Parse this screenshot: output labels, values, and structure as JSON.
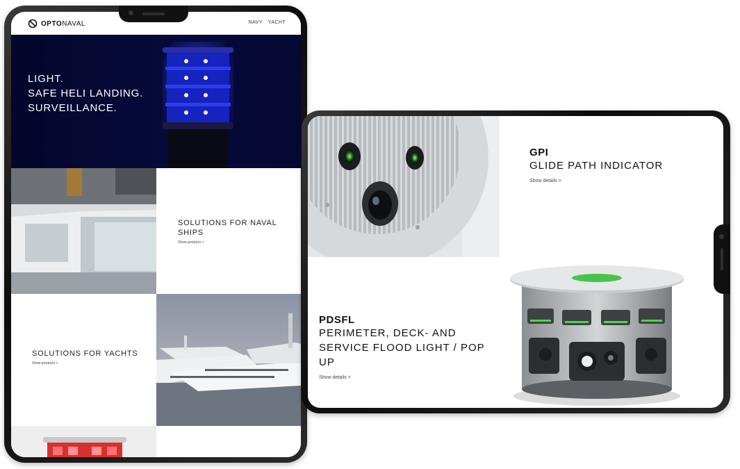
{
  "brand": {
    "name_bold": "OPTO",
    "name_light": "NAVAL",
    "accent": "#0a0f8a"
  },
  "nav": {
    "items": [
      {
        "label": "NAVY"
      },
      {
        "label": "YACHT"
      }
    ]
  },
  "hero": {
    "lines": [
      "LIGHT.",
      "SAFE HELI LANDING.",
      "SURVEILLANCE."
    ]
  },
  "tiles": {
    "naval": {
      "title": "SOLUTIONS FOR NAVAL SHIPS",
      "link": "Show products >"
    },
    "yachts": {
      "title": "SOLUTIONS FOR YACHTS",
      "link": "Show products >"
    }
  },
  "products": {
    "gpi": {
      "code": "GPI",
      "name": "GLIDE PATH INDICATOR",
      "link": "Show details >"
    },
    "pdsfl": {
      "code": "PDSFL",
      "name": "PERIMETER, DECK- AND SERVICE FLOOD LIGHT / POP UP",
      "link": "Show details >"
    }
  },
  "icons": [
    "opto-logo-icon",
    "blue-beacon-lamp-icon",
    "red-beacon-lamp-icon",
    "ship-window-image",
    "yacht-image",
    "gpi-device-image",
    "flood-light-device-image"
  ]
}
